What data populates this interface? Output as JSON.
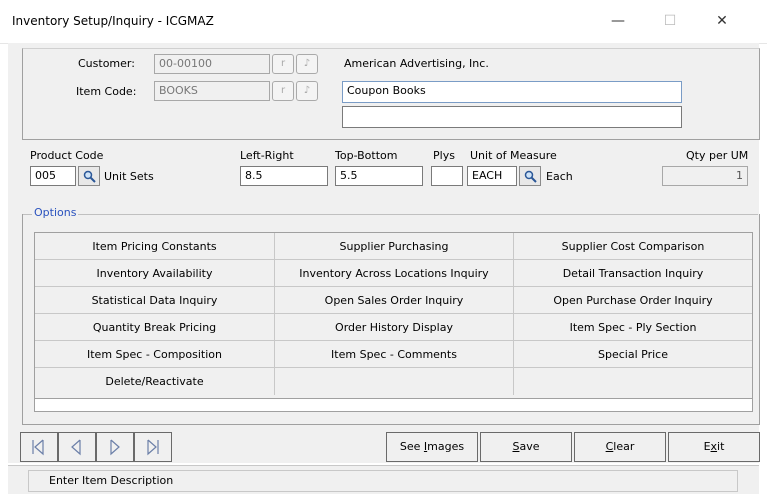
{
  "window": {
    "title": "Inventory Setup/Inquiry - ICGMAZ",
    "minimize": "—",
    "maximize": "☐",
    "close": "✕"
  },
  "header": {
    "customer_label": "Customer:",
    "customer_value": "00-00100",
    "customer_name": "American Advertising, Inc.",
    "item_code_label": "Item Code:",
    "item_code_value": "BOOKS",
    "description_1": "Coupon Books",
    "description_2": ""
  },
  "product": {
    "product_code_label": "Product Code",
    "product_code_value": "005",
    "product_code_desc": "Unit Sets",
    "left_right_label": "Left-Right",
    "left_right_value": "8.5",
    "top_bottom_label": "Top-Bottom",
    "top_bottom_value": "5.5",
    "plys_label": "Plys",
    "plys_value": "",
    "uom_label": "Unit of Measure",
    "uom_value": "EACH",
    "uom_desc": "Each",
    "qty_per_um_label": "Qty per UM",
    "qty_per_um_value": "1"
  },
  "options": {
    "legend": "Options",
    "rows": [
      [
        "Item Pricing Constants",
        "Supplier Purchasing",
        "Supplier Cost Comparison"
      ],
      [
        "Inventory Availability",
        "Inventory Across Locations Inquiry",
        "Detail Transaction Inquiry"
      ],
      [
        "Statistical Data Inquiry",
        "Open Sales Order Inquiry",
        "Open Purchase Order Inquiry"
      ],
      [
        "Quantity Break Pricing",
        "Order History Display",
        "Item Spec - Ply Section"
      ],
      [
        "Item Spec - Composition",
        "Item Spec - Comments",
        "Special Price"
      ],
      [
        "Delete/Reactivate",
        "",
        ""
      ]
    ]
  },
  "buttons": {
    "see_images": {
      "pre": "See ",
      "key": "I",
      "post": "mages"
    },
    "save": {
      "pre": "",
      "key": "S",
      "post": "ave"
    },
    "clear": {
      "pre": "",
      "key": "C",
      "post": "lear"
    },
    "exit": {
      "pre": "E",
      "key": "x",
      "post": "it"
    }
  },
  "status": {
    "message": "Enter Item Description"
  },
  "icons": {
    "lookup": "magnifier-icon",
    "nav": [
      "first-record-icon",
      "previous-record-icon",
      "next-record-icon",
      "last-record-icon"
    ]
  }
}
